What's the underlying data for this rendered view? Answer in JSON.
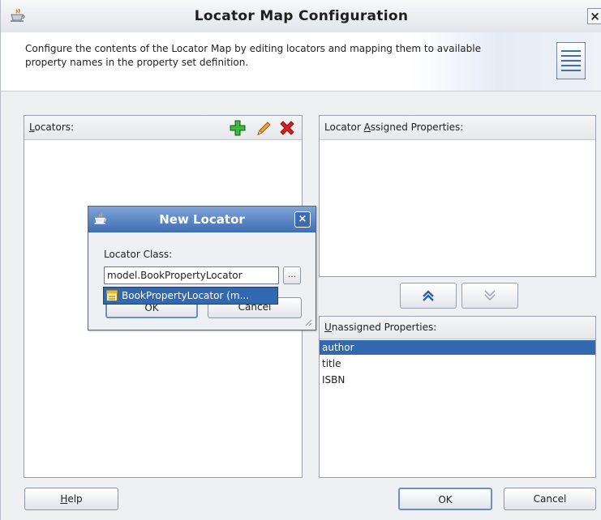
{
  "window": {
    "title": "Locator Map Configuration",
    "close_glyph": "×"
  },
  "header": {
    "description": "Configure the contents of the Locator Map by editing locators and mapping them to available property names in the property set definition."
  },
  "locators_panel": {
    "label_mnemonic": "L",
    "label_rest": "ocators:",
    "toolbar": [
      "add-icon",
      "edit-icon",
      "delete-icon"
    ]
  },
  "assigned_panel": {
    "label_pre": "Locator ",
    "label_mnemonic": "A",
    "label_rest": "ssigned Properties:"
  },
  "unassigned_panel": {
    "label_mnemonic": "U",
    "label_rest": "nassigned Properties:",
    "items": [
      "author",
      "title",
      "ISBN"
    ],
    "selected_index": 0
  },
  "buttons": {
    "help_mnemonic": "H",
    "help_rest": "elp",
    "ok": "OK",
    "cancel": "Cancel"
  },
  "dialog": {
    "title": "New Locator",
    "close_glyph": "×",
    "class_label": "Locator Class:",
    "class_value": "model.BookPropertyLocator",
    "browse_label": "...",
    "ok": "OK",
    "cancel": "Cancel",
    "suggestion": "BookPropertyLocator (m..."
  },
  "colors": {
    "selection": "#3168b0",
    "add_icon": "#2e9a2e",
    "delete_icon": "#d62020",
    "edit_icon": "#d98a1e"
  }
}
